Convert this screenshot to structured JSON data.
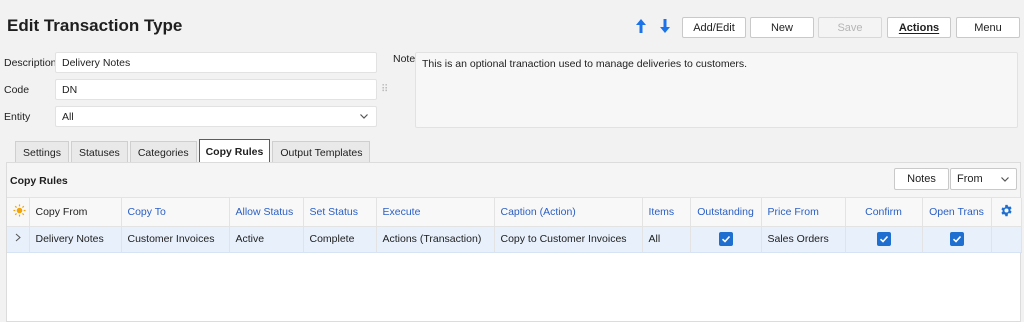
{
  "header": {
    "title": "Edit Transaction Type"
  },
  "toolbar": {
    "add_edit": "Add/Edit",
    "new": "New",
    "save": "Save",
    "actions": "Actions",
    "menu": "Menu",
    "arrow_color": "#1a73e8"
  },
  "form": {
    "description_label": "Description",
    "description_value": "Delivery Notes",
    "code_label": "Code",
    "code_value": "DN",
    "entity_label": "Entity",
    "entity_value": "All",
    "note_label": "Note",
    "note_value": "This is an optional tranaction used to manage deliveries to customers."
  },
  "tabs": [
    {
      "label": "Settings"
    },
    {
      "label": "Statuses"
    },
    {
      "label": "Categories"
    },
    {
      "label": "Copy Rules",
      "active": true
    },
    {
      "label": "Output Templates"
    }
  ],
  "copy_rules": {
    "title": "Copy Rules",
    "notes_button": "Notes",
    "from_select": "From",
    "columns": [
      "Copy From",
      "Copy To",
      "Allow Status",
      "Set Status",
      "Execute",
      "Caption (Action)",
      "Items",
      "Outstanding",
      "Price From",
      "Confirm",
      "Open Trans"
    ],
    "rows": [
      {
        "copy_from": "Delivery Notes",
        "copy_to": "Customer Invoices",
        "allow_status": "Active",
        "set_status": "Complete",
        "execute": "Actions (Transaction)",
        "caption": "Copy to Customer Invoices",
        "items": "All",
        "outstanding": true,
        "price_from": "Sales Orders",
        "confirm": true,
        "open_trans": true
      }
    ]
  },
  "colors": {
    "accent": "#1f6fd1",
    "header_link": "#2a5fc4",
    "selected_row": "#e7f0fb",
    "active_tab_border": "#d9262e",
    "sun_icon": "#f0a30a"
  }
}
